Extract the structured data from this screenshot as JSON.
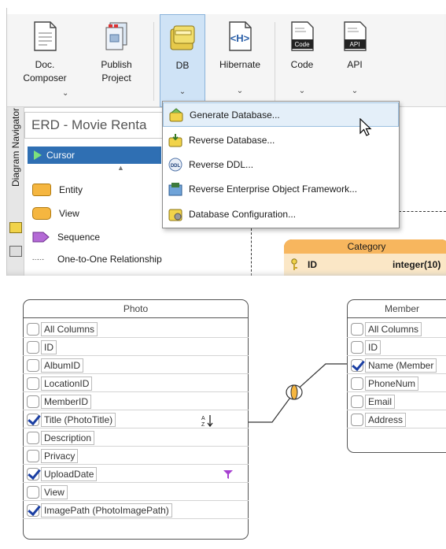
{
  "toolbar": {
    "buttons": [
      {
        "label": "Doc.\nComposer",
        "dropdown": true,
        "icon": "document-icon"
      },
      {
        "label": "Publish\nProject",
        "dropdown": false,
        "icon": "publish-icon"
      },
      {
        "label": "DB",
        "dropdown": true,
        "icon": "database-icon"
      },
      {
        "label": "Hibernate",
        "dropdown": true,
        "icon": "hibernate-icon"
      },
      {
        "label": "Code",
        "dropdown": true,
        "icon": "code-icon",
        "icon_text": "Code"
      },
      {
        "label": "API",
        "dropdown": true,
        "icon": "api-icon",
        "icon_text": "API"
      }
    ],
    "chevron": "⌄"
  },
  "side_tab": {
    "label": "Diagram Navigator"
  },
  "diagram": {
    "title": "ERD - Movie Renta"
  },
  "palette": {
    "items": [
      {
        "label": "Cursor",
        "selected": true
      },
      {
        "label": "Entity",
        "color": "#f5b640"
      },
      {
        "label": "View",
        "color": "#f5b640"
      },
      {
        "label": "Sequence",
        "color": "#b46ad6"
      },
      {
        "label": "One-to-One Relationship"
      }
    ],
    "up_arrow": "▲",
    "relationship_glyph": "-·-·-"
  },
  "db_menu": {
    "items": [
      {
        "label": "Generate Database...",
        "icon": "generate-db-icon",
        "hover": true
      },
      {
        "label": "Reverse Database...",
        "icon": "reverse-db-icon"
      },
      {
        "label": "Reverse DDL...",
        "icon": "ddl-icon",
        "icon_text": "DDL"
      },
      {
        "label": "Reverse Enterprise Object Framework...",
        "icon": "eof-icon"
      },
      {
        "label": "Database Configuration...",
        "icon": "db-config-icon"
      }
    ]
  },
  "category_entity": {
    "name": "Category",
    "column": "ID",
    "type": "integer(10)"
  },
  "photo_table": {
    "name": "Photo",
    "rows": [
      {
        "label": "All Columns",
        "checked": false
      },
      {
        "label": "ID",
        "checked": false
      },
      {
        "label": "AlbumID",
        "checked": false
      },
      {
        "label": "LocationID",
        "checked": false
      },
      {
        "label": "MemberID",
        "checked": false
      },
      {
        "label": "Title (PhotoTitle)",
        "checked": true,
        "badge": "A↓Z"
      },
      {
        "label": "Description",
        "checked": false
      },
      {
        "label": "Privacy",
        "checked": false
      },
      {
        "label": "UploadDate",
        "checked": true,
        "badge": "filter"
      },
      {
        "label": "View",
        "checked": false
      },
      {
        "label": "ImagePath (PhotoImagePath)",
        "checked": true
      }
    ]
  },
  "member_table": {
    "name": "Member",
    "rows": [
      {
        "label": "All Columns",
        "checked": false
      },
      {
        "label": "ID",
        "checked": false
      },
      {
        "label": "Name (Member",
        "checked": true
      },
      {
        "label": "PhoneNum",
        "checked": false
      },
      {
        "label": "Email",
        "checked": false
      },
      {
        "label": "Address",
        "checked": false
      }
    ]
  },
  "colors": {
    "accent": "#2f6fb3",
    "entity_fill": "#fde2b3",
    "entity_header": "#f7b65e",
    "filter": "#a640d0"
  }
}
